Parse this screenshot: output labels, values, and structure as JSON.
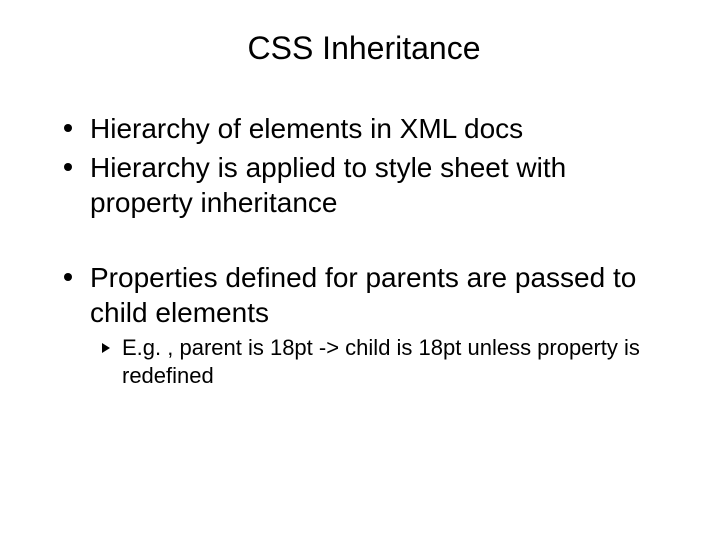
{
  "title": "CSS Inheritance",
  "bullets": {
    "b1": "Hierarchy of elements in XML docs",
    "b2": "Hierarchy is applied to style sheet with property inheritance",
    "b3": "Properties defined for parents are passed to child elements",
    "b3_sub1": "E.g. , parent is 18pt -> child is 18pt unless property is redefined"
  }
}
